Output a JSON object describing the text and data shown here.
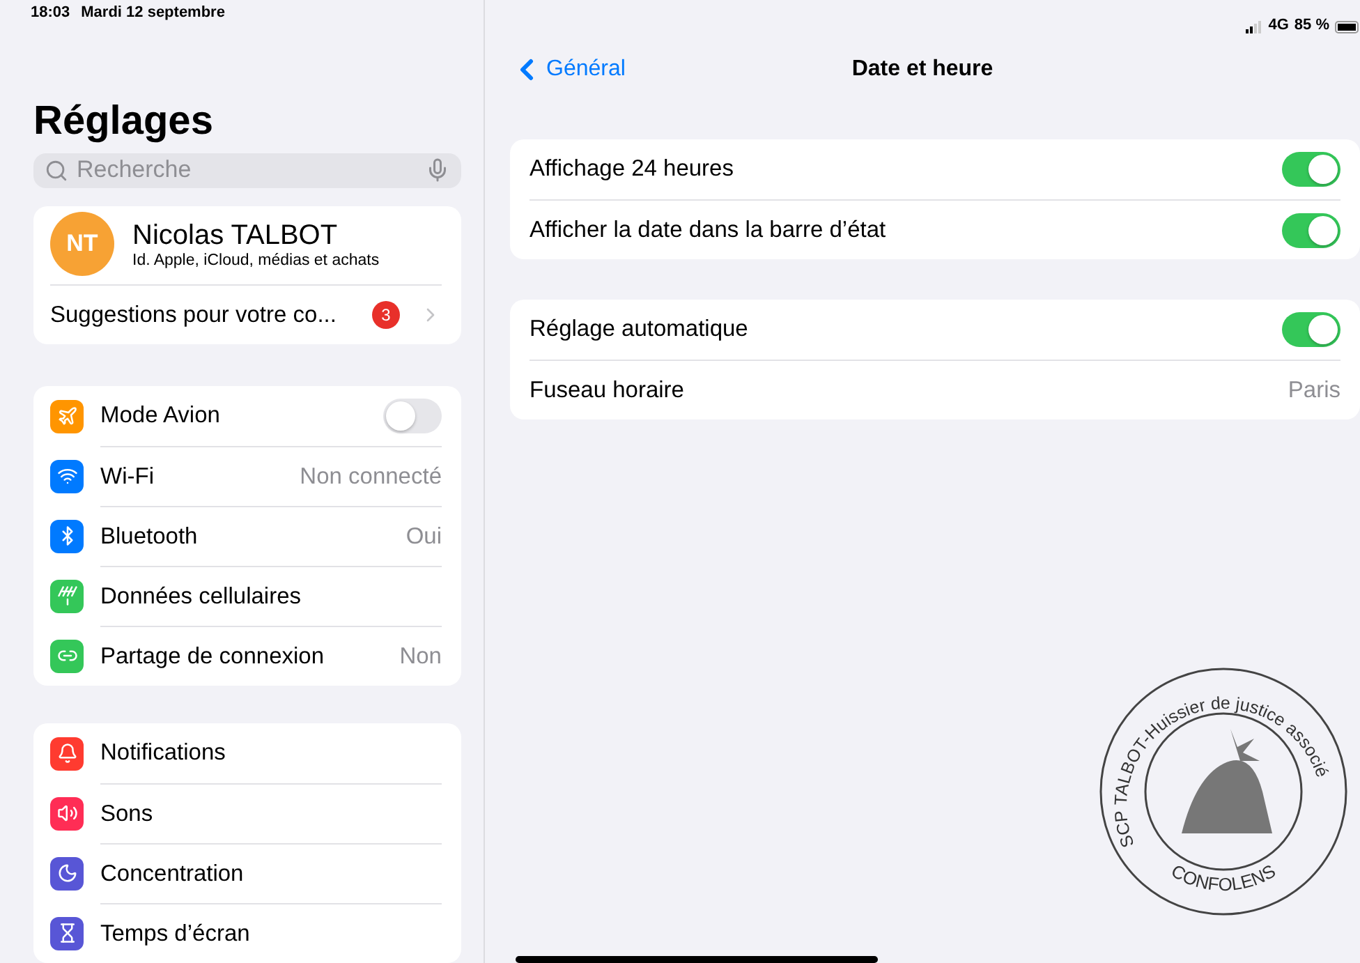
{
  "status_bar": {
    "time": "18:03",
    "date": "Mardi 12 septembre",
    "network": "4G",
    "battery": "85 %"
  },
  "sidebar": {
    "title": "Réglages",
    "search": {
      "placeholder": "Recherche"
    },
    "profile": {
      "initials": "NT",
      "name": "Nicolas TALBOT",
      "subtitle": "Id. Apple, iCloud, médias et achats",
      "suggestion": "Suggestions pour votre co...",
      "badge": "3"
    },
    "groups": [
      [
        {
          "label": "Mode Avion",
          "color": "#ff9500",
          "kind": "toggle",
          "on": false
        },
        {
          "label": "Wi-Fi",
          "color": "#007aff",
          "kind": "value",
          "value": "Non connecté"
        },
        {
          "label": "Bluetooth",
          "color": "#007aff",
          "kind": "value",
          "value": "Oui"
        },
        {
          "label": "Données cellulaires",
          "color": "#34c759",
          "kind": "plain"
        },
        {
          "label": "Partage de connexion",
          "color": "#34c759",
          "kind": "value",
          "value": "Non"
        }
      ],
      [
        {
          "label": "Notifications",
          "color": "#ff3b30",
          "kind": "plain"
        },
        {
          "label": "Sons",
          "color": "#ff2d55",
          "kind": "plain"
        },
        {
          "label": "Concentration",
          "color": "#5856d6",
          "kind": "plain"
        },
        {
          "label": "Temps d’écran",
          "color": "#5856d6",
          "kind": "plain"
        }
      ]
    ]
  },
  "detail": {
    "back": "Général",
    "title": "Date et heure",
    "groups": [
      [
        {
          "label": "Affichage 24 heures",
          "kind": "toggle",
          "on": true
        },
        {
          "label": "Afficher la date dans la barre d’état",
          "kind": "toggle",
          "on": true
        }
      ],
      [
        {
          "label": "Réglage automatique",
          "kind": "toggle",
          "on": true
        },
        {
          "label": "Fuseau horaire",
          "kind": "value",
          "value": "Paris"
        }
      ]
    ]
  },
  "stamp": {
    "ring_text": "SCP TALBOT-Huissier de justice associé",
    "bottom_text": "CONFOLENS"
  }
}
